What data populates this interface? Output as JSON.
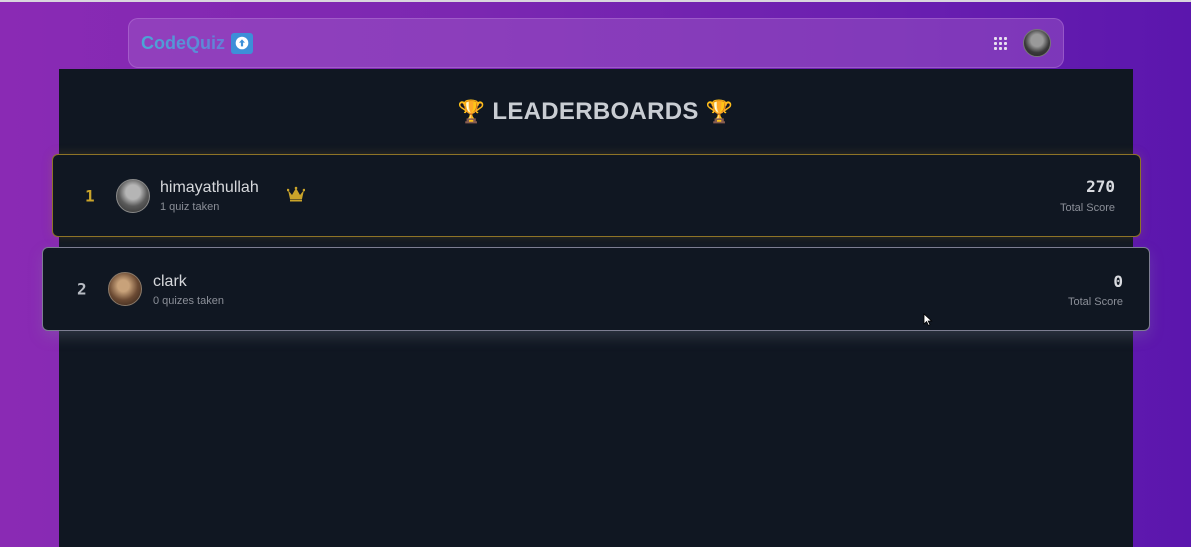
{
  "navbar": {
    "brand": "CodeQuiz",
    "brand_icon": "upload-arrow-icon",
    "apps_icon": "grid-icon",
    "avatar_icon": "user-avatar"
  },
  "page": {
    "title": "LEADERBOARDS",
    "trophy_glyph": "🏆"
  },
  "leaderboard": [
    {
      "rank": "1",
      "name": "himayathullah",
      "quizzes": "1 quiz taken",
      "score": "270",
      "score_label": "Total Score",
      "badge_icon": "crown-icon"
    },
    {
      "rank": "2",
      "name": "clark",
      "quizzes": "0 quizes taken",
      "score": "0",
      "score_label": "Total Score"
    }
  ],
  "colors": {
    "gold": "#caa42a",
    "panel_bg": "#101722",
    "gradient_start": "#8a2ab4",
    "gradient_end": "#5b16ad"
  }
}
